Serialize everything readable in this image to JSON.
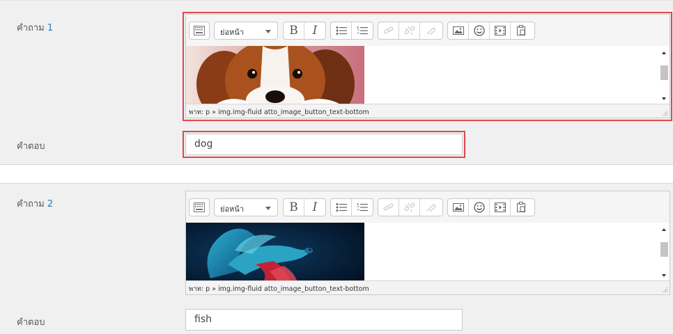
{
  "questions": [
    {
      "label": "คำถาม",
      "number": "1",
      "paragraph_style": "ย่อหน้า",
      "path_text": "พาท: p » img.img-fluid atto_image_button_text-bottom",
      "answer_label": "คำตอบ",
      "answer_value": "dog",
      "image_subject": "puppy-photo"
    },
    {
      "label": "คำถาม",
      "number": "2",
      "paragraph_style": "ย่อหน้า",
      "path_text": "พาท: p » img.img-fluid atto_image_button_text-bottom",
      "answer_label": "คำตอบ",
      "answer_value": "fish",
      "image_subject": "betta-fish-photo"
    }
  ],
  "toolbar_icons": [
    "show-more-icon",
    "bold-icon",
    "italic-icon",
    "bullet-list-icon",
    "numbered-list-icon",
    "link-icon",
    "unlink-icon",
    "manage-files-icon",
    "image-icon",
    "emoticon-icon",
    "media-icon",
    "paste-icon"
  ],
  "colors": {
    "highlight": "#e0484f",
    "link_number": "#2a7ab8"
  }
}
